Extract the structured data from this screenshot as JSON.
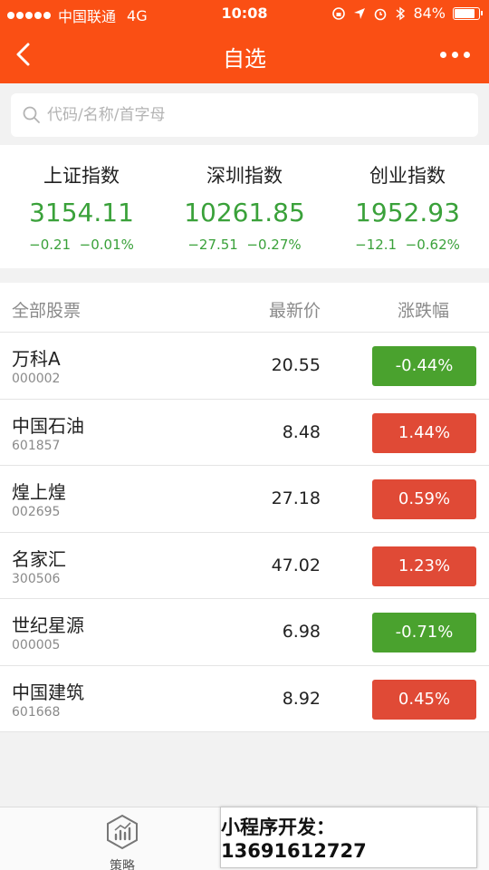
{
  "status_bar": {
    "carrier": "中国联通",
    "network": "4G",
    "time": "10:08",
    "battery": "84%",
    "battery_level": 0.84
  },
  "nav": {
    "title": "自选",
    "back_icon": "chevron-left-icon",
    "more_icon": "more-dots-icon"
  },
  "search": {
    "placeholder": "代码/名称/首字母",
    "value": ""
  },
  "indices": [
    {
      "name": "上证指数",
      "value": "3154.11",
      "change": "−0.21",
      "pct": "−0.01%"
    },
    {
      "name": "深圳指数",
      "value": "10261.85",
      "change": "−27.51",
      "pct": "−0.27%"
    },
    {
      "name": "创业指数",
      "value": "1952.93",
      "change": "−12.1",
      "pct": "−0.62%"
    }
  ],
  "list": {
    "headers": [
      "全部股票",
      "最新价",
      "涨跌幅"
    ],
    "rows": [
      {
        "name": "万科A",
        "code": "000002",
        "price": "20.55",
        "pct": "-0.44%",
        "dir": "down"
      },
      {
        "name": "中国石油",
        "code": "601857",
        "price": "8.48",
        "pct": "1.44%",
        "dir": "up"
      },
      {
        "name": "煌上煌",
        "code": "002695",
        "price": "27.18",
        "pct": "0.59%",
        "dir": "up"
      },
      {
        "name": "名家汇",
        "code": "300506",
        "price": "47.02",
        "pct": "1.23%",
        "dir": "up"
      },
      {
        "name": "世纪星源",
        "code": "000005",
        "price": "6.98",
        "pct": "-0.71%",
        "dir": "down"
      },
      {
        "name": "中国建筑",
        "code": "601668",
        "price": "8.92",
        "pct": "0.45%",
        "dir": "up"
      }
    ]
  },
  "tabbar": {
    "tab_label": "策略"
  },
  "watermark": "小程序开发：13691612727",
  "colors": {
    "brand": "#fa4f14",
    "down": "#4aa22e",
    "up": "#e04a36",
    "index_green": "#3aa13a"
  }
}
